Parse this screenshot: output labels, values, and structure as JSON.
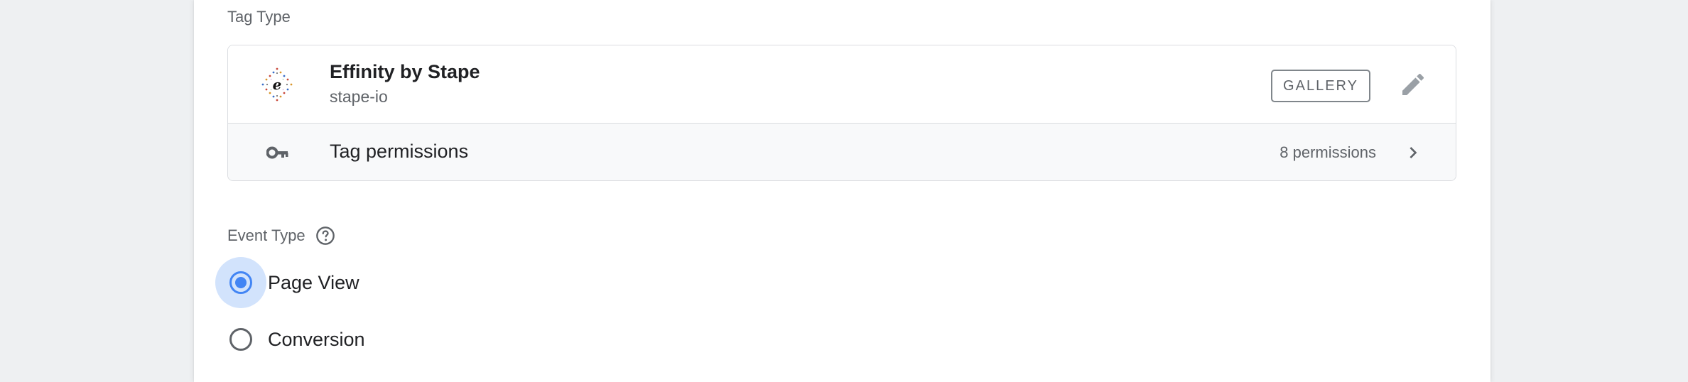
{
  "tag_type": {
    "label": "Tag Type",
    "tag_name": "Effinity by Stape",
    "tag_publisher": "stape-io",
    "logo_letter": "e",
    "badge": "GALLERY",
    "permissions_label": "Tag permissions",
    "permissions_count": "8 permissions"
  },
  "event_type": {
    "label": "Event Type",
    "options": [
      {
        "label": "Page View",
        "selected": true
      },
      {
        "label": "Conversion",
        "selected": false
      }
    ]
  },
  "colors": {
    "accent": "#4285f4",
    "focus_halo": "#d2e3fc",
    "text_primary": "#202124",
    "text_secondary": "#5f6368"
  },
  "icons": {
    "logo": "effinity-logo-icon",
    "edit": "pencil-icon",
    "permissions": "key-icon",
    "navigate": "chevron-right-icon",
    "help": "help-circle-icon"
  }
}
